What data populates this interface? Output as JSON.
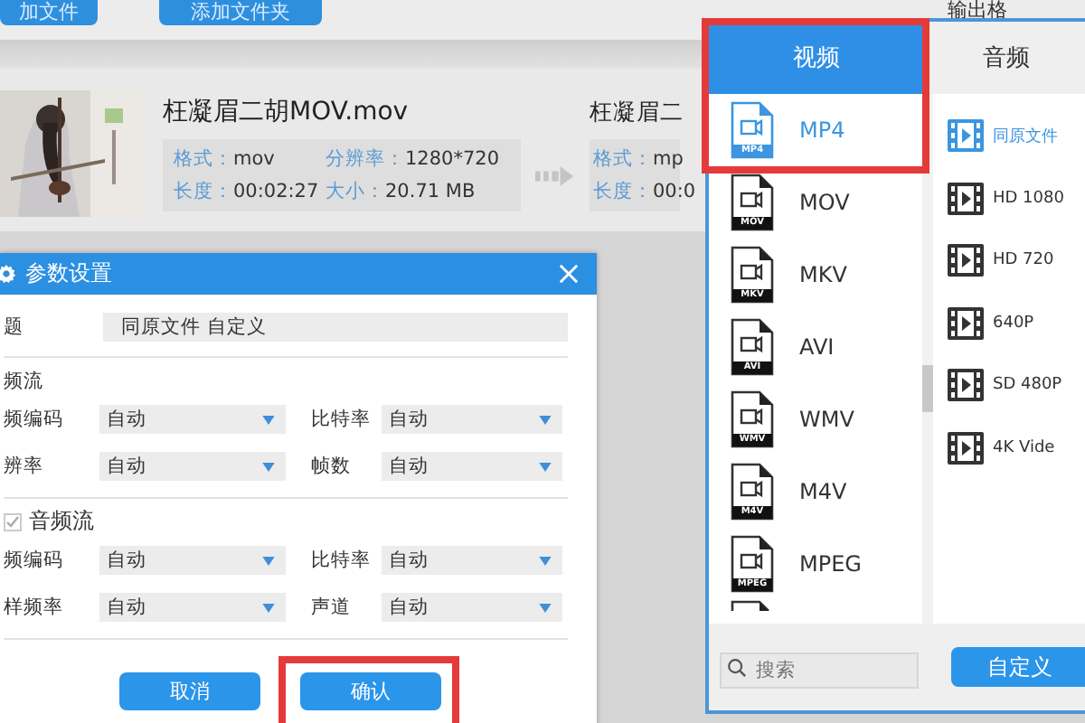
{
  "toolbar": {
    "buttons": [
      "加文件",
      "添加文件夹"
    ]
  },
  "output_label": "输出格",
  "source_file": {
    "kind": "picture",
    "name": "枉凝眉二胡MOV.mov",
    "fields": [
      {
        "label": "格式：",
        "value": "mov"
      },
      {
        "label": "分辨率：",
        "value": "1280*720"
      },
      {
        "label": "长度：",
        "value": "00:02:27"
      },
      {
        "label": "大小：",
        "value": "20.71 MB"
      }
    ]
  },
  "output_file": {
    "name": "枉凝眉二",
    "fields": [
      {
        "label": "格式：",
        "value": "mp"
      },
      {
        "label": "长度：",
        "value": "00:0"
      }
    ]
  },
  "dialog": {
    "title": "参数设置",
    "title_field": {
      "label": "题",
      "value": "同原文件 自定义"
    },
    "sections": [
      {
        "heading": "频流",
        "kind": "plain",
        "rows": [
          [
            {
              "label": "频编码",
              "value": "自动"
            },
            {
              "label": "比特率",
              "value": "自动"
            }
          ],
          [
            {
              "label": "辨率",
              "value": "自动"
            },
            {
              "label": "帧数",
              "value": "自动"
            }
          ]
        ]
      },
      {
        "heading": "音频流",
        "kind": "checkbox",
        "checked": true,
        "rows": [
          [
            {
              "label": "频编码",
              "value": "自动"
            },
            {
              "label": "比特率",
              "value": "自动"
            }
          ],
          [
            {
              "label": "样频率",
              "value": "自动"
            },
            {
              "label": "声道",
              "value": "自动"
            }
          ]
        ]
      }
    ],
    "buttons": [
      {
        "label": "取消",
        "highlighted": false
      },
      {
        "label": "确认",
        "highlighted": true
      }
    ]
  },
  "format_panel": {
    "highlighted": true,
    "tabs": [
      {
        "label": "视频",
        "selected": true
      },
      {
        "label": "音频",
        "selected": false
      }
    ],
    "formats": [
      {
        "kind": "full",
        "label": "MP4",
        "badge": "MP4",
        "selected": true
      },
      {
        "kind": "full",
        "label": "MOV",
        "badge": "MOV",
        "selected": false
      },
      {
        "kind": "full",
        "label": "MKV",
        "badge": "MKV",
        "selected": false
      },
      {
        "kind": "full",
        "label": "AVI",
        "badge": "AVI",
        "selected": false
      },
      {
        "kind": "full",
        "label": "WMV",
        "badge": "WMV",
        "selected": false
      },
      {
        "kind": "full",
        "label": "M4V",
        "badge": "M4V",
        "selected": false
      },
      {
        "kind": "full",
        "label": "MPEG",
        "badge": "MPEG",
        "selected": false
      },
      {
        "kind": "partial"
      }
    ],
    "presets": [
      {
        "label": "同原文件",
        "selected": true
      },
      {
        "label": "HD 1080",
        "selected": false
      },
      {
        "label": "HD 720",
        "selected": false
      },
      {
        "label": "640P",
        "selected": false
      },
      {
        "label": "SD 480P",
        "selected": false
      },
      {
        "label": "4K Vide",
        "selected": false
      }
    ],
    "search": {
      "placeholder": "搜索"
    },
    "custom_button": "自定义"
  }
}
